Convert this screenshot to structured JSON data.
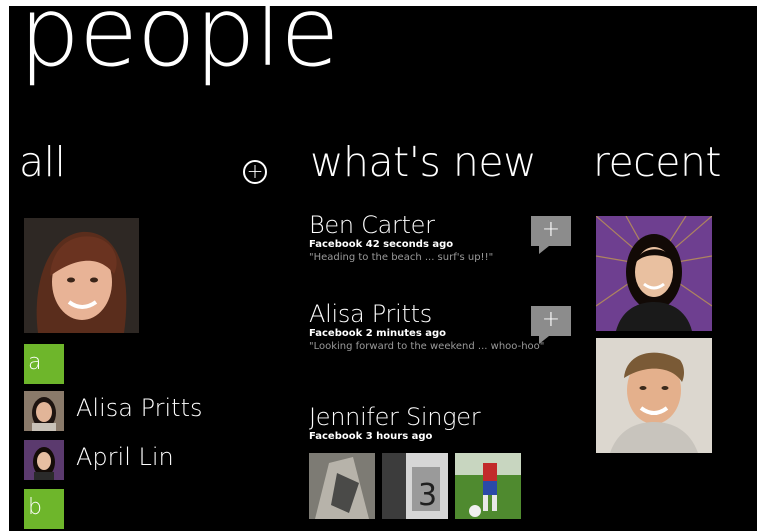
{
  "page": {
    "title": "people"
  },
  "sections": {
    "all": {
      "title": "all",
      "add_icon": "plus-circle-icon"
    },
    "whats_new": {
      "title": "what's new"
    },
    "recent": {
      "title": "recent"
    }
  },
  "all_list": {
    "groups": [
      {
        "letter": "a",
        "contacts": [
          "Alisa Pritts",
          "April Lin"
        ]
      },
      {
        "letter": "b",
        "contacts": []
      }
    ]
  },
  "feed": [
    {
      "name": "Ben Carter",
      "source": "Facebook 42 seconds ago",
      "message": "\"Heading to the beach ... surf's up!!\"",
      "action_label": "+"
    },
    {
      "name": "Alisa Pritts",
      "source": "Facebook 2 minutes ago",
      "message": "\"Looking forward to the weekend ... whoo-hoo\"",
      "action_label": "+"
    },
    {
      "name": "Jennifer Singer",
      "source": "Facebook 3 hours ago",
      "message": ""
    }
  ],
  "colors": {
    "background": "#000000",
    "accent": "#6eb62b",
    "secondary_text": "#9a9a9a",
    "comment_tile": "#8c8c8c"
  }
}
